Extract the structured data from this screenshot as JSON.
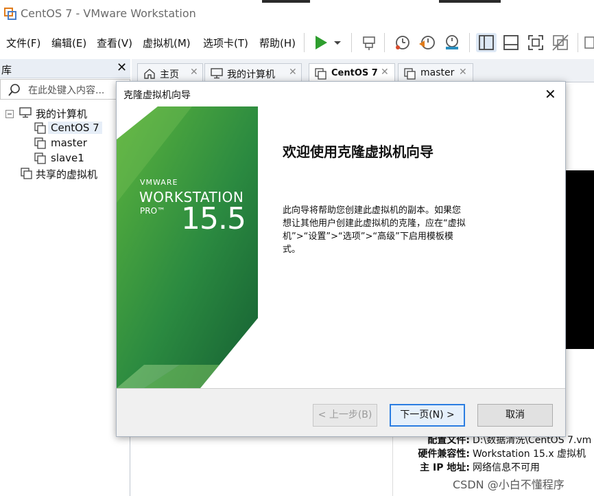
{
  "window": {
    "title": "CentOS 7 - VMware Workstation"
  },
  "menubar": {
    "items": [
      "文件(F)",
      "编辑(E)",
      "查看(V)",
      "虚拟机(M)",
      "选项卡(T)",
      "帮助(H)"
    ]
  },
  "toolbar": {
    "icons": [
      "play-icon",
      "dropdown-arrow-icon",
      "send-ctrl-alt-del-icon",
      "snapshot-icon",
      "revert-snapshot-icon",
      "snapshot-manager-icon",
      "library-view-icon",
      "thumbnail-bar-icon",
      "fullscreen-icon",
      "unity-icon"
    ]
  },
  "library": {
    "header": "库",
    "search_placeholder": "在此处键入内容...",
    "tree": [
      {
        "label": "我的计算机",
        "icon": "computer-icon"
      },
      {
        "label": "CentOS 7",
        "icon": "vm-icon",
        "selected": true
      },
      {
        "label": "master",
        "icon": "vm-icon"
      },
      {
        "label": "slave1",
        "icon": "vm-icon"
      },
      {
        "label": "共享的虚拟机",
        "icon": "shared-vm-icon"
      }
    ]
  },
  "tabs": [
    {
      "label": "主页",
      "icon": "home-icon"
    },
    {
      "label": "我的计算机",
      "icon": "computer-icon"
    },
    {
      "label": "CentOS 7",
      "icon": "vm-icon",
      "active": true
    },
    {
      "label": "master",
      "icon": "vm-icon"
    }
  ],
  "vm_details": {
    "rows": [
      {
        "key": "配置文件:",
        "value": "D:\\数据清洗\\CentOS 7.vm"
      },
      {
        "key": "硬件兼容性:",
        "value": "Workstation 15.x 虚拟机"
      },
      {
        "key": "主 IP 地址:",
        "value": "网络信息不可用"
      }
    ]
  },
  "dialog": {
    "title": "克隆虚拟机向导",
    "banner": {
      "brand": "VMWARE",
      "product": "WORKSTATION",
      "edition": "PRO™",
      "version": "15.5"
    },
    "heading": "欢迎使用克隆虚拟机向导",
    "body": "此向导将帮助您创建此虚拟机的副本。如果您想让其他用户创建此虚拟机的克隆，应在“虚拟机”>“设置”>“选项”>“高级”下启用模板模式。",
    "buttons": {
      "back": "< 上一步(B)",
      "next": "下一页(N) >",
      "cancel": "取消"
    }
  },
  "watermark": "CSDN @小白不懂程序",
  "colors": {
    "banner_green_dark": "#1b6b38",
    "banner_green_light": "#4fae3a",
    "primary_button_border": "#2a7de1",
    "play_green": "#2e9e2e"
  }
}
